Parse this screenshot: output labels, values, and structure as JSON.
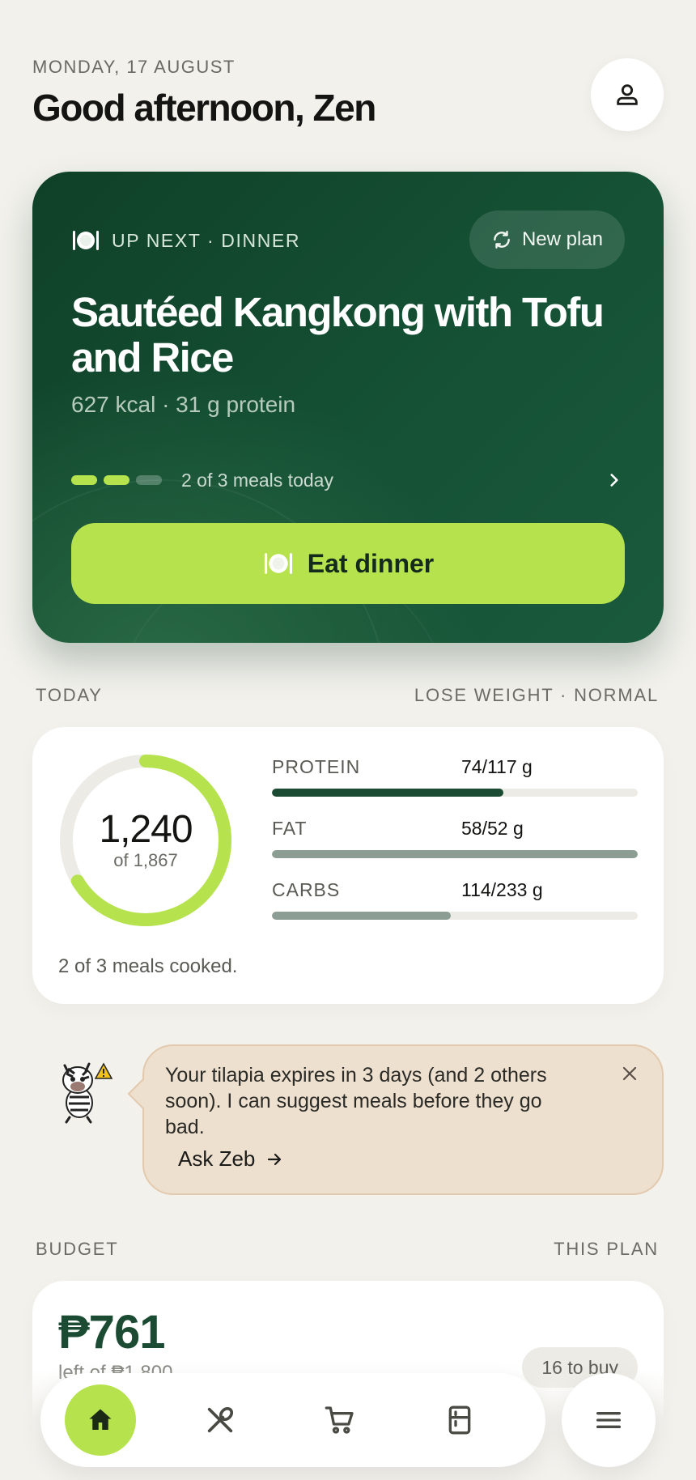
{
  "header": {
    "date": "MONDAY, 17 AUGUST",
    "greeting": "Good afternoon, Zen"
  },
  "up_next": {
    "label": "UP NEXT · DINNER",
    "new_plan_label": "New plan",
    "meal_title": "Sautéed Kangkong with Tofu and Rice",
    "meal_meta": "627 kcal · 31 g protein",
    "meals_done": 2,
    "meals_total": 3,
    "progress_text": "2 of 3 meals today",
    "cta_label": "Eat dinner"
  },
  "today": {
    "section_label": "TODAY",
    "goal_label": "LOSE WEIGHT · NORMAL",
    "calories_eaten": "1,240",
    "calories_target": "of 1,867",
    "calories_fraction": 0.664,
    "macros": [
      {
        "name": "PROTEIN",
        "value": "74/117 g",
        "fraction": 0.632,
        "color": "#1b4b32"
      },
      {
        "name": "FAT",
        "value": "58/52 g",
        "fraction": 1.0,
        "color": "#8c9e93"
      },
      {
        "name": "CARBS",
        "value": "114/233 g",
        "fraction": 0.489,
        "color": "#8c9e93"
      }
    ],
    "cooked_text": "2 of 3 meals cooked."
  },
  "zeb": {
    "message": "Your tilapia expires in 3 days (and 2 others soon). I can suggest meals before they go bad.",
    "action_label": "Ask Zeb"
  },
  "budget": {
    "section_label": "BUDGET",
    "scope_label": "THIS PLAN",
    "amount": "₱761",
    "left_text": "left of ₱1,800",
    "to_buy": "16 to buy"
  },
  "nav": {
    "items": [
      "home-icon",
      "utensils-icon",
      "cart-icon",
      "fridge-icon"
    ],
    "menu_icon": "menu-icon"
  },
  "colors": {
    "accent": "#b6e34d",
    "hero_green": "#155135",
    "background": "#f2f1ec"
  }
}
